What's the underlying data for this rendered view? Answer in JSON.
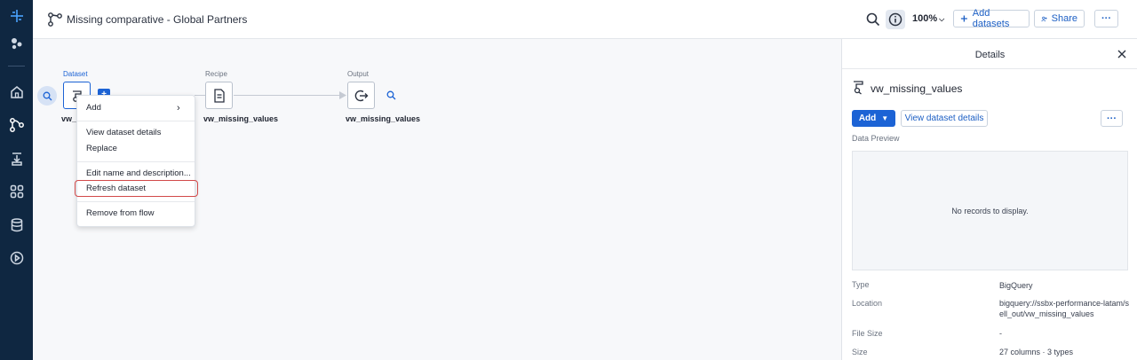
{
  "header": {
    "title": "Missing comparative - Global Partners",
    "zoom": "100%",
    "add_datasets_label": "Add datasets",
    "share_label": "Share",
    "more_label": "···"
  },
  "flow": {
    "dataset_label": "Dataset",
    "dataset_name_partial": "vw_m",
    "recipe_label": "Recipe",
    "recipe_name": "vw_missing_values",
    "output_label": "Output",
    "output_name": "vw_missing_values",
    "badge": "+"
  },
  "context_menu": {
    "add": "Add",
    "view_details": "View dataset details",
    "replace": "Replace",
    "edit_name": "Edit name and description...",
    "refresh": "Refresh dataset",
    "remove": "Remove from flow"
  },
  "details": {
    "title": "Details",
    "dataset_name": "vw_missing_values",
    "add_label": "Add",
    "view_details_label": "View dataset details",
    "more_label": "···",
    "data_preview_label": "Data Preview",
    "empty_message": "No records to display.",
    "props": {
      "type_key": "Type",
      "type_val": "BigQuery",
      "location_key": "Location",
      "location_val": "bigquery://ssbx-performance-latam/sell_out/vw_missing_values",
      "filesize_key": "File Size",
      "filesize_val": "-",
      "size_key": "Size",
      "size_val": "27 columns · 3 types"
    }
  },
  "colors": {
    "rail": "#0f2741",
    "accent": "#1c63d5",
    "highlight": "#d24a4a"
  }
}
